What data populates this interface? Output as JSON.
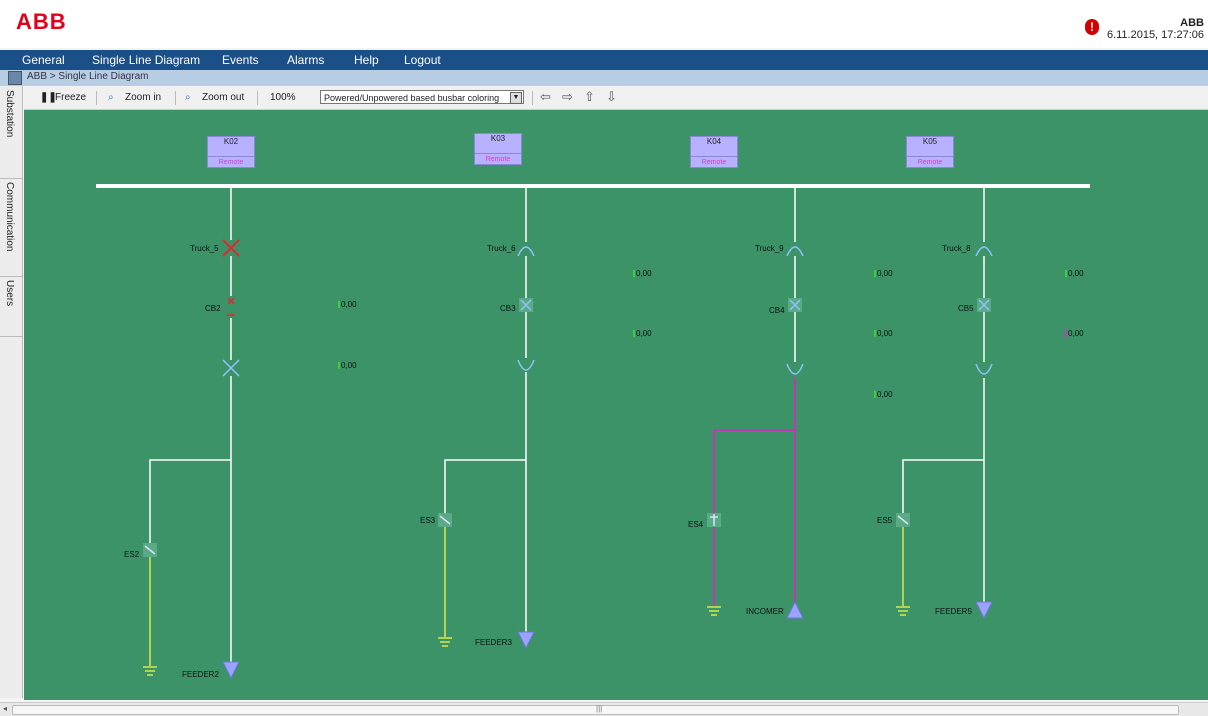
{
  "header": {
    "logo": "ABB",
    "user": "ABB",
    "datetime": "6.11.2015, 17:27:06",
    "alert_icon": "alarm-exclamation-icon"
  },
  "menu": [
    "General",
    "Single Line Diagram",
    "Events",
    "Alarms",
    "Help",
    "Logout"
  ],
  "breadcrumb": "ABB > Single Line Diagram",
  "toolbar": {
    "freeze": "Freeze",
    "zoom_in": "Zoom in",
    "zoom_out": "Zoom out",
    "zoom_level": "100%",
    "coloring": "Powered/Unpowered based busbar coloring"
  },
  "sidetabs": [
    "Substation",
    "Communication",
    "Users"
  ],
  "colors": {
    "canvas": "#3c9368",
    "menubar": "#1b4f88",
    "bay_box": "#b7b1ff",
    "feeder_arrow": "#9aa3ff",
    "earth_line": "#d6e84a",
    "powered_line": "#c038b8",
    "open_breaker": "#e0282e"
  },
  "bays": [
    {
      "name": "K02",
      "mode": "Remote",
      "truck": "Truck_5",
      "cb": "CB2",
      "es": "ES2",
      "feeder": "FEEDER2"
    },
    {
      "name": "K03",
      "mode": "Remote",
      "truck": "Truck_6",
      "cb": "CB3",
      "es": "ES3",
      "feeder": "FEEDER3"
    },
    {
      "name": "K04",
      "mode": "Remote",
      "truck": "Truck_9",
      "cb": "CB4",
      "es": "ES4",
      "feeder": "INCOMER"
    },
    {
      "name": "K05",
      "mode": "Remote",
      "truck": "Truck_8",
      "cb": "CB5",
      "es": "ES5",
      "feeder": "FEEDER5"
    }
  ],
  "measurements": [
    "0,00",
    "0,00",
    "0,00",
    "0,00",
    "0,00",
    "0,00",
    "0,00",
    "0,00",
    "0,00"
  ]
}
